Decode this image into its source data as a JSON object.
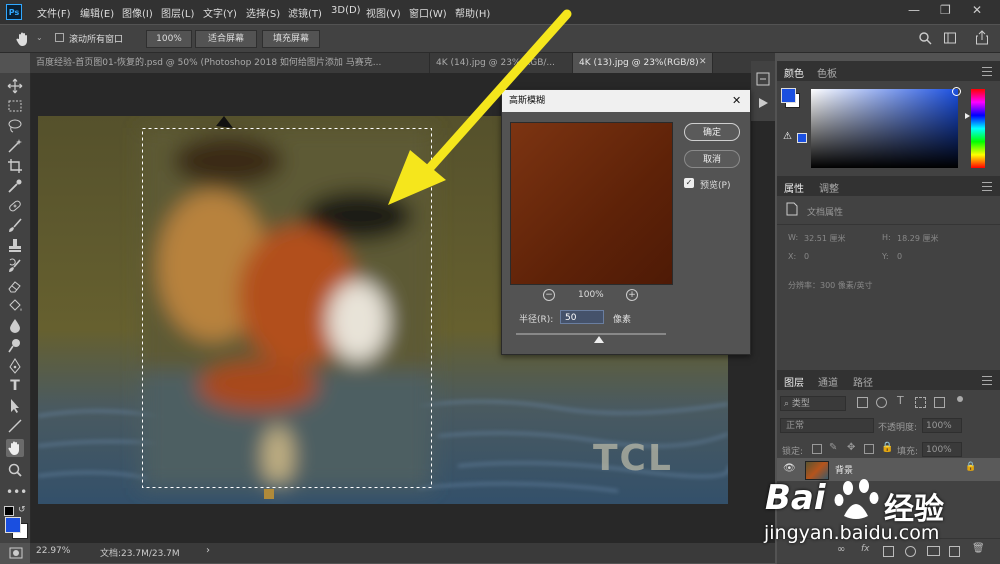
{
  "app": {
    "logo": "Ps",
    "menu": [
      "文件(F)",
      "编辑(E)",
      "图像(I)",
      "图层(L)",
      "文字(Y)",
      "选择(S)",
      "滤镜(T)",
      "3D(D)",
      "视图(V)",
      "窗口(W)",
      "帮助(H)"
    ],
    "window_controls": [
      "—",
      "❐",
      "✕"
    ]
  },
  "options_bar": {
    "scroll_all_label": "滚动所有窗口",
    "scroll_all_checked": false,
    "zoom_100": "100%",
    "fit_screen": "适合屏幕",
    "fill_screen": "填充屏幕"
  },
  "tabs": [
    {
      "label": "百度经验-首页图01-恢复的.psd @ 50% (Photoshop 2018  如何给图片添加 马赛克...",
      "active": false
    },
    {
      "label": "4K (14).jpg @ 23%(RGB/...",
      "active": false
    },
    {
      "label": "4K (13).jpg @ 23%(RGB/8)",
      "active": true
    }
  ],
  "toolbar": {
    "tools": [
      "move-tool-icon",
      "marquee-tool-icon",
      "lasso-tool-icon",
      "magic-wand-icon",
      "crop-tool-icon",
      "eyedropper-icon",
      "healing-brush-icon",
      "brush-tool-icon",
      "stamp-tool-icon",
      "history-brush-icon",
      "eraser-icon",
      "paint-bucket-icon",
      "blur-tool-icon",
      "dodge-tool-icon",
      "pen-tool-icon",
      "type-tool-icon",
      "path-select-icon",
      "line-tool-icon",
      "hand-tool-icon",
      "zoom-tool-icon",
      "more-tools-icon"
    ],
    "type_tool_glyph": "T",
    "foreground_color": "#1a4fe0",
    "background_color": "#ffffff"
  },
  "canvas": {
    "photo_watermark": "TCL"
  },
  "status_bar": {
    "zoom": "22.97%",
    "doc_size": "文档:23.7M/23.7M",
    "arrow": "›"
  },
  "dialog": {
    "title": "高斯模糊",
    "close": "✕",
    "ok": "确定",
    "cancel": "取消",
    "preview_label": "预览(P)",
    "preview_checked": true,
    "zoom_level": "100%",
    "zoom_out": "−",
    "zoom_in": "+",
    "radius_label": "半径(R):",
    "radius_value": "50",
    "radius_unit": "像素",
    "slider_fraction": 0.55
  },
  "color_panel": {
    "tabs": [
      "颜色",
      "色板"
    ],
    "hue_color": "#1a4fe0"
  },
  "properties_panel": {
    "tabs": [
      "属性",
      "调整"
    ],
    "section_title": "文档属性",
    "w_label": "W:",
    "w_value": "32.51 厘米",
    "h_label": "H:",
    "h_value": "18.29 厘米",
    "x_label": "X:",
    "x_value": "0",
    "y_label": "Y:",
    "y_value": "0",
    "resolution": "分辨率：300 像素/英寸"
  },
  "layers_panel": {
    "tabs": [
      "图层",
      "通道",
      "路径"
    ],
    "filter_kind": "类型",
    "blend_mode": "正常",
    "opacity_label": "不透明度:",
    "opacity_value": "100%",
    "lock_label": "锁定:",
    "fill_label": "填充:",
    "fill_value": "100%",
    "layer_name": "背景",
    "footer_icons": [
      "link-icon",
      "fx-icon",
      "mask-icon",
      "adjustment-icon",
      "folder-icon",
      "new-layer-icon",
      "trash-icon"
    ]
  },
  "watermark": {
    "brand": "Bai",
    "brand_cn": "经验",
    "url": "jingyan.baidu.com"
  },
  "annotation": {
    "arrow_color": "#f5e61c"
  }
}
